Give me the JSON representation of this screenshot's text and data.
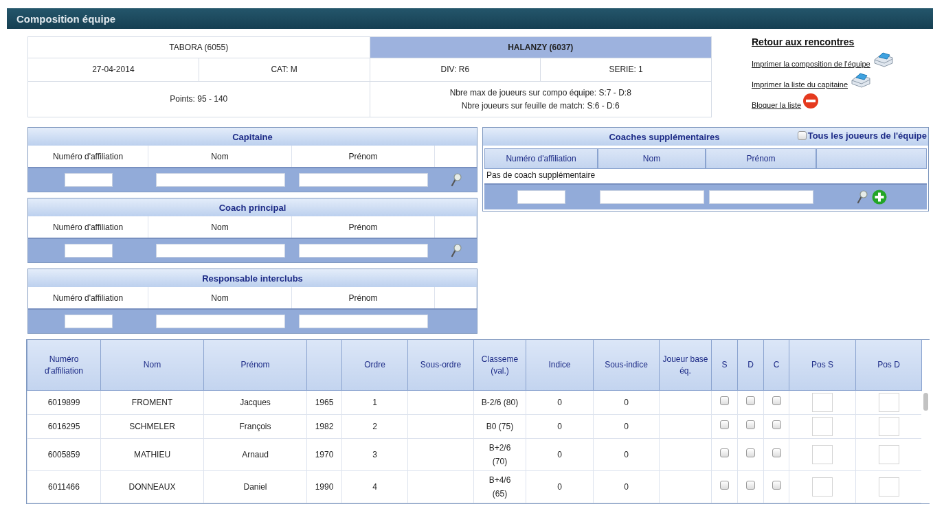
{
  "header": {
    "title": "Composition équipe"
  },
  "match": {
    "home": "TABORA (6055)",
    "away": "HALANZY (6037)",
    "date": "27-04-2014",
    "category": "CAT: M",
    "division": "DIV: R6",
    "serie": "SERIE: 1",
    "points": "Points: 95 - 140",
    "limits": [
      "Nbre max de joueurs sur compo équipe: S:7 - D:8",
      "Nbre joueurs sur feuille de match: S:6 - D:6"
    ]
  },
  "links": [
    {
      "kind": "title",
      "label": "Retour aux rencontres"
    },
    {
      "kind": "print",
      "label": "Imprimer la composition de l'équipe"
    },
    {
      "kind": "print",
      "label": "Imprimer la liste du capitaine"
    },
    {
      "kind": "block",
      "label": "Bloquer la liste"
    }
  ],
  "panels": [
    {
      "title": "Capitaine",
      "columns": [
        "Numéro d'affiliation",
        "Nom",
        "Prénom"
      ],
      "search": true
    },
    {
      "title": "Coach principal",
      "columns": [
        "Numéro d'affiliation",
        "Nom",
        "Prénom"
      ],
      "search": true
    },
    {
      "title": "Responsable interclubs",
      "columns": [
        "Numéro d'affiliation",
        "Nom",
        "Prénom"
      ],
      "search": false
    }
  ],
  "coaches": {
    "title": "Coaches supplémentaires",
    "all_players": {
      "label": "Tous les joueurs de l'équipe",
      "checked": false
    },
    "columns": [
      "Numéro d'affiliation",
      "Nom",
      "Prénom"
    ],
    "empty": "Pas de coach supplémentaire"
  },
  "players": {
    "columns": [
      "Numéro d'affiliation",
      "Nom",
      "Prénom",
      "",
      "Ordre",
      "Sous-ordre",
      "Classeme (val.)",
      "Indice",
      "Sous-indice",
      "Joueur base éq.",
      "S",
      "D",
      "C",
      "Pos S",
      "Pos D"
    ],
    "rows": [
      {
        "cells": [
          "6019899",
          "FROMENT",
          "Jacques",
          "1965",
          "1",
          "",
          "B-2/6 (80)",
          "0",
          "0",
          ""
        ],
        "s": false,
        "d": false,
        "c": false
      },
      {
        "cells": [
          "6016295",
          "SCHMELER",
          "François",
          "1982",
          "2",
          "",
          "B0 (75)",
          "0",
          "0",
          ""
        ],
        "s": false,
        "d": false,
        "c": false
      },
      {
        "cells": [
          "6005859",
          "MATHIEU",
          "Arnaud",
          "1970",
          "3",
          "",
          "B+2/6 (70)",
          "0",
          "0",
          ""
        ],
        "s": false,
        "d": false,
        "c": false
      },
      {
        "cells": [
          "6011466",
          "DONNEAUX",
          "Daniel",
          "1990",
          "4",
          "",
          "B+4/6 (65)",
          "0",
          "0",
          ""
        ],
        "s": false,
        "d": false,
        "c": false
      }
    ]
  }
}
